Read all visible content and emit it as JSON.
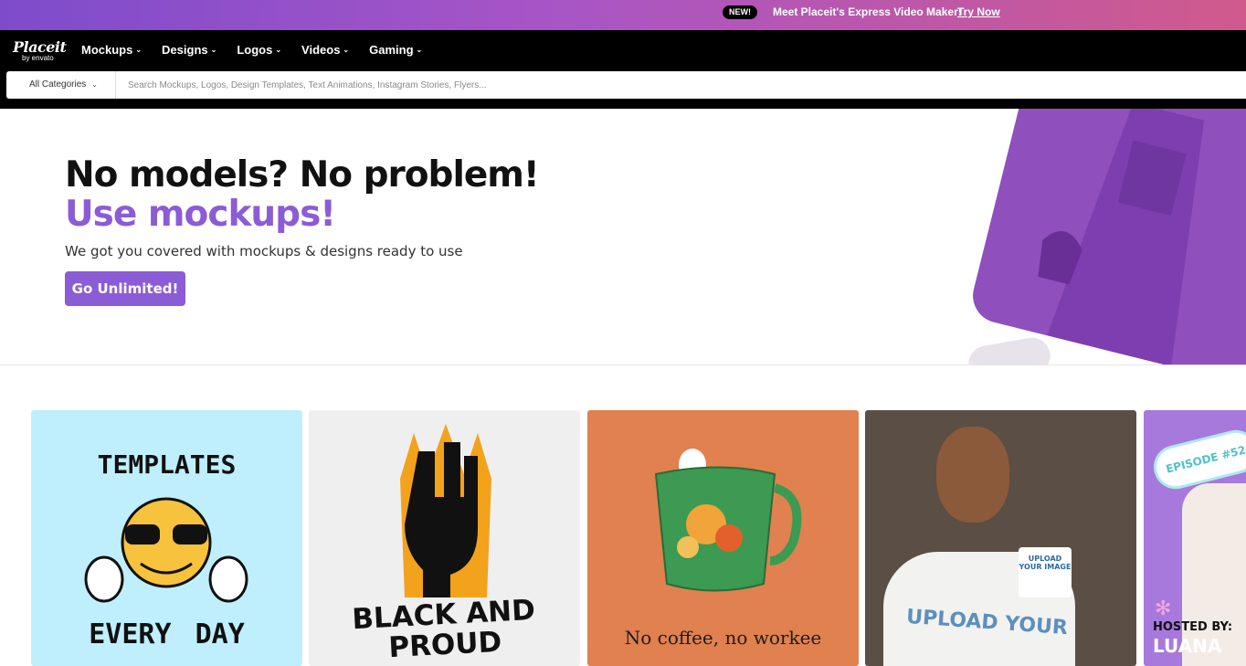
{
  "promo": {
    "badge": "NEW!",
    "message": "Meet Placeit's Express Video Maker!",
    "link": "Try Now"
  },
  "logo": {
    "word": "Placeit",
    "sub": "by envato"
  },
  "nav": {
    "items": [
      "Mockups",
      "Designs",
      "Logos",
      "Videos",
      "Gaming"
    ]
  },
  "search": {
    "category": "All Categories",
    "placeholder": "Search Mockups, Logos, Design Templates, Text Animations, Instagram Stories, Flyers..."
  },
  "hero": {
    "line1": "No models? No problem!",
    "line2": "Use mockups!",
    "subtitle": "We got you covered with mockups & designs ready to use",
    "cta": "Go Unlimited!"
  },
  "cards": {
    "c1": {
      "top": "TEMPLATES",
      "bottom": "EVERY DAY"
    },
    "c2": {
      "text": "BLACK AND PROUD"
    },
    "c3": {
      "text": "No coffee, no workee"
    },
    "c4": {
      "shirt": "UPLOAD YOUR",
      "mug": "UPLOAD YOUR IMAGE"
    },
    "c5": {
      "episode": "EPISODE #52",
      "host": "HOSTED BY:",
      "name": "LUANA"
    }
  },
  "colors": {
    "accent": "#8b5cd6",
    "nav": "#000000"
  }
}
